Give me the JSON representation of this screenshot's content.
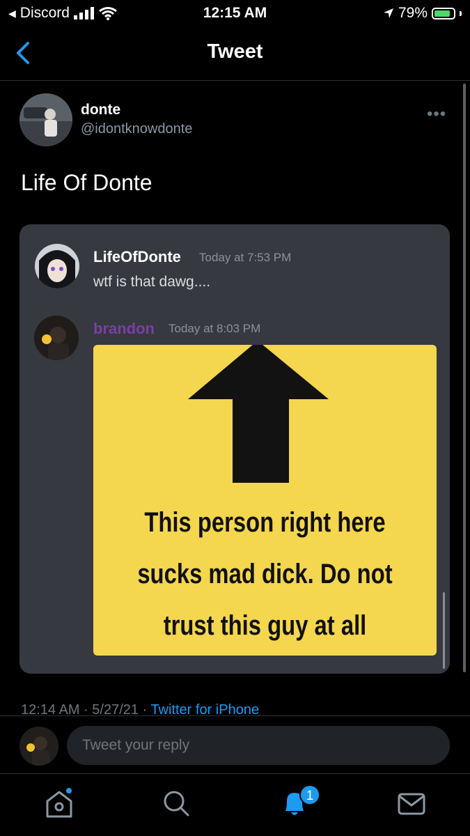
{
  "status_bar": {
    "back_app": "Discord",
    "time": "12:15 AM",
    "battery": "79%",
    "battery_level": 0.79
  },
  "nav": {
    "title": "Tweet"
  },
  "tweet": {
    "author_name": "donte",
    "author_handle": "@idontknowdonte",
    "more": "•••",
    "text": "Life Of Donte",
    "timestamp": "12:14 AM · 5/27/21 ·",
    "source": "Twitter for iPhone"
  },
  "discord": {
    "messages": [
      {
        "username": "LifeOfDonte",
        "timestamp": "Today at 7:53 PM",
        "text": "wtf is that dawg...."
      },
      {
        "username": "brandon",
        "timestamp": "Today at 8:03 PM",
        "image_text": [
          "This person right here",
          "sucks mad dick. Do not",
          "trust this guy at all"
        ]
      }
    ],
    "colors": {
      "card_bg": "#36393f",
      "brandon_name": "#7b3fa6",
      "meme_bg": "#f4d64f"
    }
  },
  "reply": {
    "placeholder": "Tweet your reply"
  },
  "tab_bar": {
    "items": [
      {
        "icon": "home-icon"
      },
      {
        "icon": "search-icon"
      },
      {
        "icon": "notifications-bell-icon",
        "badge": "1"
      },
      {
        "icon": "messages-envelope-icon"
      }
    ]
  }
}
